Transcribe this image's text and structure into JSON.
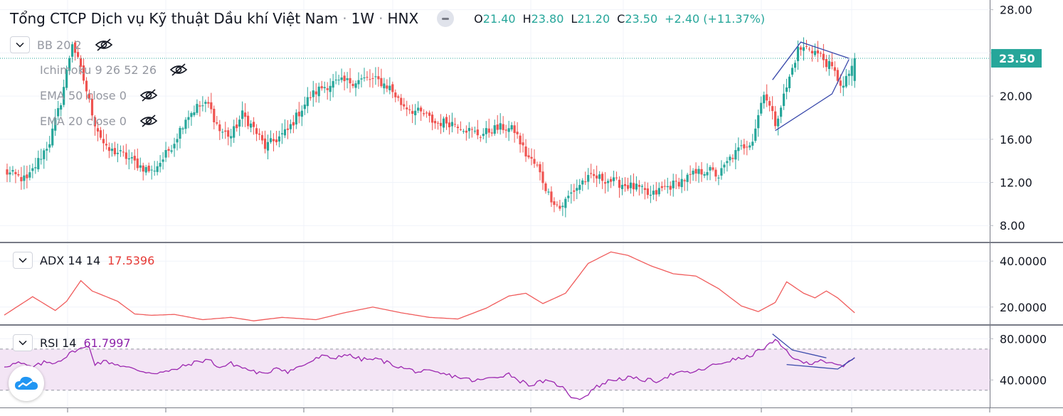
{
  "header": {
    "title": "Tổng CTCP Dịch vụ Kỹ thuật Dầu khí Việt Nam",
    "interval": "1W",
    "exchange": "HNX",
    "ohlc": {
      "o_label": "O",
      "o": "21.40",
      "h_label": "H",
      "h": "23.80",
      "l_label": "L",
      "l": "21.20",
      "c_label": "C",
      "c": "23.50",
      "change": "+2.40 (+11.37%)"
    }
  },
  "indicators": [
    {
      "label": "BB 20 2"
    },
    {
      "label": "Ichimoku 9 26 52 26"
    },
    {
      "label": "EMA 50 close 0"
    },
    {
      "label": "EMA 20 close 0"
    }
  ],
  "panes": {
    "adx": {
      "label": "ADX 14 14",
      "value": "17.5396"
    },
    "rsi": {
      "label": "RSI 14",
      "value": "61.7997"
    }
  },
  "colors": {
    "up": "#26a69a",
    "down": "#ef5350",
    "adx": "#f05c5c",
    "rsi": "#9c27b0",
    "rsi_band": "#f3e5f5",
    "drawing": "#3949ab"
  },
  "icons": {
    "logo": "tradingview-cloud-logo",
    "hide": "eye-off-icon",
    "collapse": "chevron-down-icon"
  },
  "chart_data": [
    {
      "type": "candlestick",
      "price_axis": {
        "ticks": [
          "28.00",
          "24.00",
          "20.00",
          "16.00",
          "12.00",
          "8.00"
        ],
        "ylim": [
          6.5,
          28.9
        ]
      },
      "last_price_label": "23.50",
      "last_price": 23.5,
      "anchors": [
        [
          0,
          13.0
        ],
        [
          4,
          12.6
        ],
        [
          8,
          12.2
        ],
        [
          12,
          14.0
        ],
        [
          16,
          15.8
        ],
        [
          20,
          19.5
        ],
        [
          24,
          25.0
        ],
        [
          28,
          21.5
        ],
        [
          32,
          17.5
        ],
        [
          36,
          15.0
        ],
        [
          40,
          14.8
        ],
        [
          44,
          14.2
        ],
        [
          48,
          13.5
        ],
        [
          52,
          13.0
        ],
        [
          56,
          14.2
        ],
        [
          60,
          15.8
        ],
        [
          64,
          18.0
        ],
        [
          68,
          19.0
        ],
        [
          72,
          19.2
        ],
        [
          76,
          16.8
        ],
        [
          80,
          16.3
        ],
        [
          84,
          18.3
        ],
        [
          88,
          17.0
        ],
        [
          92,
          15.3
        ],
        [
          96,
          16.0
        ],
        [
          100,
          16.8
        ],
        [
          104,
          18.5
        ],
        [
          108,
          20.0
        ],
        [
          112,
          20.8
        ],
        [
          116,
          21.2
        ],
        [
          120,
          21.3
        ],
        [
          124,
          21.4
        ],
        [
          128,
          21.6
        ],
        [
          132,
          21.4
        ],
        [
          136,
          20.8
        ],
        [
          140,
          19.3
        ],
        [
          144,
          18.7
        ],
        [
          148,
          18.3
        ],
        [
          152,
          17.5
        ],
        [
          156,
          17.6
        ],
        [
          160,
          17.4
        ],
        [
          164,
          16.8
        ],
        [
          168,
          16.4
        ],
        [
          172,
          16.9
        ],
        [
          176,
          17.1
        ],
        [
          180,
          16.8
        ],
        [
          184,
          14.6
        ],
        [
          188,
          13.4
        ],
        [
          192,
          10.9
        ],
        [
          196,
          9.6
        ],
        [
          200,
          11.0
        ],
        [
          204,
          12.1
        ],
        [
          208,
          12.5
        ],
        [
          212,
          12.3
        ],
        [
          216,
          12.0
        ],
        [
          220,
          11.7
        ],
        [
          224,
          11.4
        ],
        [
          228,
          10.7
        ],
        [
          232,
          11.4
        ],
        [
          236,
          11.8
        ],
        [
          240,
          12.3
        ],
        [
          244,
          12.8
        ],
        [
          248,
          13.2
        ],
        [
          252,
          12.6
        ],
        [
          256,
          14.2
        ],
        [
          260,
          15.2
        ],
        [
          264,
          16.0
        ],
        [
          268,
          20.5
        ],
        [
          272,
          17.5
        ],
        [
          276,
          20.8
        ],
        [
          280,
          24.3
        ],
        [
          284,
          24.5
        ],
        [
          288,
          23.7
        ],
        [
          292,
          22.5
        ],
        [
          296,
          20.8
        ],
        [
          300,
          23.5
        ]
      ],
      "drawing": {
        "upper": [
          [
            271,
            21.5
          ],
          [
            281,
            25.0
          ],
          [
            298,
            23.5
          ]
        ],
        "lower": [
          [
            272,
            16.8
          ],
          [
            292,
            20.2
          ],
          [
            298,
            23.4
          ]
        ]
      }
    },
    {
      "type": "line",
      "name": "ADX 14 14",
      "y_ticks": [
        "40.0000",
        "20.0000"
      ],
      "ylim": [
        12.5,
        47.8
      ],
      "anchors": [
        [
          0,
          16.5
        ],
        [
          5,
          20.5
        ],
        [
          10,
          24.5
        ],
        [
          14,
          21.5
        ],
        [
          18,
          18.5
        ],
        [
          22,
          22.5
        ],
        [
          27,
          31.5
        ],
        [
          31,
          27.0
        ],
        [
          36,
          24.5
        ],
        [
          40,
          22.5
        ],
        [
          46,
          17.0
        ],
        [
          52,
          16.4
        ],
        [
          60,
          16.8
        ],
        [
          70,
          14.5
        ],
        [
          80,
          15.5
        ],
        [
          88,
          14.0
        ],
        [
          98,
          15.5
        ],
        [
          110,
          14.5
        ],
        [
          120,
          17.5
        ],
        [
          130,
          20.0
        ],
        [
          140,
          17.5
        ],
        [
          150,
          15.5
        ],
        [
          160,
          14.8
        ],
        [
          170,
          19.5
        ],
        [
          178,
          24.8
        ],
        [
          184,
          26.0
        ],
        [
          190,
          21.5
        ],
        [
          198,
          26.0
        ],
        [
          206,
          39.0
        ],
        [
          214,
          44.0
        ],
        [
          220,
          42.5
        ],
        [
          228,
          38.0
        ],
        [
          236,
          34.5
        ],
        [
          244,
          33.5
        ],
        [
          252,
          28.0
        ],
        [
          260,
          20.5
        ],
        [
          266,
          18.0
        ],
        [
          272,
          22.0
        ],
        [
          276,
          31.0
        ],
        [
          282,
          26.0
        ],
        [
          286,
          24.0
        ],
        [
          290,
          27.0
        ],
        [
          294,
          24.0
        ],
        [
          300,
          17.5
        ]
      ]
    },
    {
      "type": "line",
      "name": "RSI 14",
      "y_ticks": [
        "80.0000",
        "40.0000"
      ],
      "ylim": [
        13.3,
        92.7
      ],
      "band": [
        30,
        70
      ],
      "anchors": [
        [
          0,
          53.5
        ],
        [
          5,
          56.5
        ],
        [
          10,
          52.0
        ],
        [
          14,
          57.0
        ],
        [
          18,
          57.0
        ],
        [
          22,
          63.0
        ],
        [
          25,
          69.0
        ],
        [
          30,
          72.0
        ],
        [
          32,
          56.0
        ],
        [
          36,
          58.0
        ],
        [
          40,
          55.0
        ],
        [
          46,
          50.0
        ],
        [
          52,
          47.0
        ],
        [
          58,
          48.0
        ],
        [
          66,
          56.0
        ],
        [
          72,
          60.0
        ],
        [
          76,
          52.0
        ],
        [
          80,
          56.0
        ],
        [
          86,
          50.0
        ],
        [
          92,
          45.0
        ],
        [
          96,
          53.0
        ],
        [
          100,
          48.0
        ],
        [
          106,
          55.0
        ],
        [
          112,
          63.0
        ],
        [
          116,
          61.0
        ],
        [
          120,
          65.0
        ],
        [
          126,
          60.0
        ],
        [
          132,
          60.0
        ],
        [
          136,
          56.0
        ],
        [
          140,
          52.0
        ],
        [
          146,
          48.0
        ],
        [
          150,
          48.0
        ],
        [
          156,
          45.0
        ],
        [
          160,
          43.0
        ],
        [
          166,
          39.0
        ],
        [
          172,
          42.0
        ],
        [
          178,
          46.0
        ],
        [
          182,
          39.0
        ],
        [
          186,
          35.0
        ],
        [
          190,
          39.0
        ],
        [
          196,
          35.0
        ],
        [
          200,
          24.0
        ],
        [
          204,
          22.0
        ],
        [
          208,
          32.0
        ],
        [
          214,
          40.0
        ],
        [
          220,
          42.0
        ],
        [
          226,
          40.0
        ],
        [
          230,
          39.0
        ],
        [
          236,
          46.0
        ],
        [
          244,
          48.0
        ],
        [
          250,
          54.0
        ],
        [
          256,
          59.0
        ],
        [
          262,
          62.0
        ],
        [
          268,
          71.0
        ],
        [
          272,
          78.0
        ],
        [
          276,
          68.0
        ],
        [
          280,
          58.0
        ],
        [
          284,
          56.0
        ],
        [
          288,
          60.0
        ],
        [
          292,
          55.0
        ],
        [
          296,
          53.0
        ],
        [
          300,
          61.8
        ]
      ],
      "drawing": {
        "upper": [
          [
            271,
            84.7
          ],
          [
            278,
            69.1
          ],
          [
            290,
            61.5
          ]
        ],
        "lower": [
          [
            276,
            55.0
          ],
          [
            294,
            50.6
          ],
          [
            300,
            61.5
          ]
        ]
      }
    }
  ]
}
